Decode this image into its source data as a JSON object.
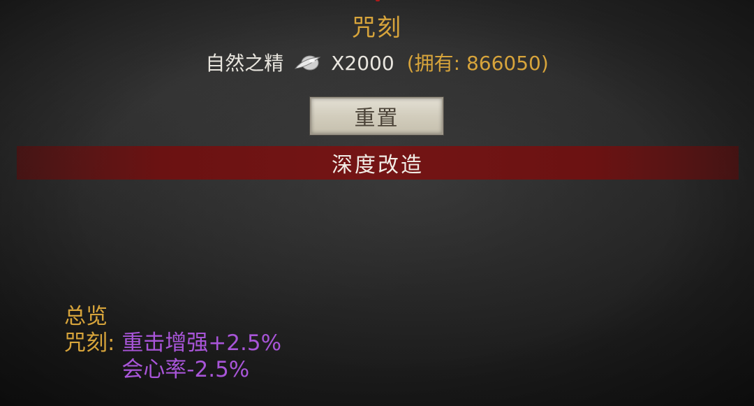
{
  "header": {
    "title": "咒刻"
  },
  "cost": {
    "material_name": "自然之精",
    "material_icon": "seed-orb-icon",
    "amount": "X2000",
    "owned": "(拥有: 866050)"
  },
  "actions": {
    "reset_label": "重置"
  },
  "deep_bar": {
    "label": "深度改造"
  },
  "summary": {
    "heading": "总览",
    "label": "咒刻: ",
    "effects": [
      "重击增强+2.5%",
      "会心率-2.5%"
    ]
  },
  "colors": {
    "gold": "#d7a43b",
    "purple": "#a855d8",
    "bar_red": "#741515"
  }
}
